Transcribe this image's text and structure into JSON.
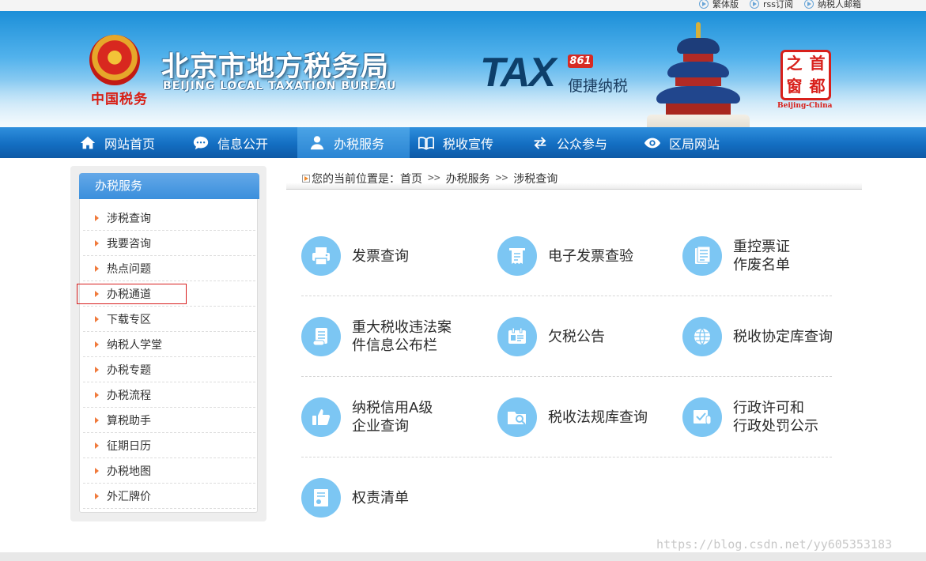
{
  "topbar": {
    "links": [
      "繁体版",
      "rss订阅",
      "纳税人邮箱"
    ]
  },
  "banner": {
    "emblem_text": "中国税务",
    "title_cn": "北京市地方税务局",
    "title_en": "BEIJING LOCAL TAXATION BUREAU",
    "tax_word": "TAX",
    "tax_badge": "861",
    "tax_slogan": "便捷纳税",
    "seal_chars": [
      "首",
      "之",
      "都",
      "窗"
    ],
    "seal_caption": "Beijing-China"
  },
  "nav": {
    "items": [
      "网站首页",
      "信息公开",
      "办税服务",
      "税收宣传",
      "公众参与",
      "区局网站"
    ],
    "active_index": 2
  },
  "sidebar": {
    "title": "办税服务",
    "items": [
      "涉税查询",
      "我要咨询",
      "热点问题",
      "办税通道",
      "下载专区",
      "纳税人学堂",
      "办税专题",
      "办税流程",
      "算税助手",
      "征期日历",
      "办税地图",
      "外汇牌价"
    ],
    "highlighted_index": 3
  },
  "breadcrumb": {
    "prefix": "您的当前位置是：",
    "items": [
      "首页",
      "办税服务",
      "涉税查询"
    ],
    "separator": ">>"
  },
  "services": [
    {
      "line1": "发票查询",
      "line2": "",
      "icon": "printer-icon"
    },
    {
      "line1": "电子发票查验",
      "line2": "",
      "icon": "receipt-icon"
    },
    {
      "line1": "重控票证",
      "line2": "作废名单",
      "icon": "document-list-icon"
    },
    {
      "line1": "重大税收违法案",
      "line2": "件信息公布栏",
      "icon": "scroll-icon"
    },
    {
      "line1": "欠税公告",
      "line2": "",
      "icon": "calendar-card-icon"
    },
    {
      "line1": "税收协定库查询",
      "line2": "",
      "icon": "globe-icon"
    },
    {
      "line1": "纳税信用A级",
      "line2": "企业查询",
      "icon": "thumbs-up-icon"
    },
    {
      "line1": "税收法规库查询",
      "line2": "",
      "icon": "folder-search-icon"
    },
    {
      "line1": "行政许可和",
      "line2": "行政处罚公示",
      "icon": "check-board-icon"
    },
    {
      "line1": "权责清单",
      "line2": "",
      "icon": "certificate-icon"
    }
  ],
  "colors": {
    "nav_blue": "#136ec2",
    "accent_light_blue": "#7cc6f3",
    "highlight_red": "#d81e1e"
  },
  "watermark": "https://blog.csdn.net/yy605353183"
}
